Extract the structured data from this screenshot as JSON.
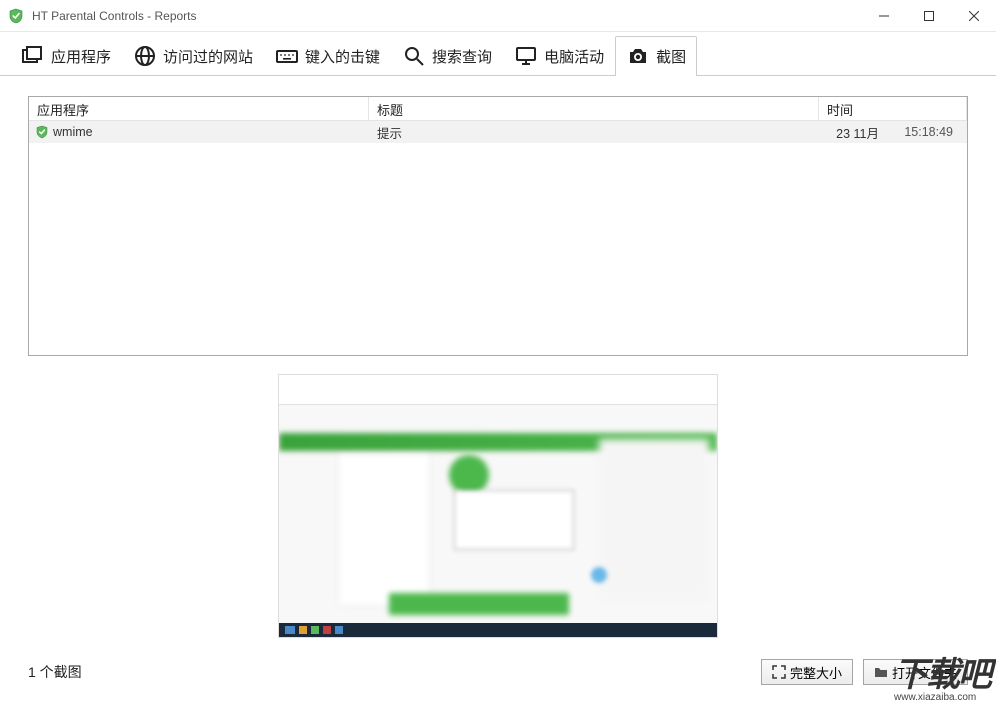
{
  "window": {
    "title": "HT Parental Controls - Reports"
  },
  "tabs": [
    {
      "id": "apps",
      "label": "应用程序"
    },
    {
      "id": "websites",
      "label": "访问过的网站"
    },
    {
      "id": "keystrokes",
      "label": "键入的击键"
    },
    {
      "id": "search",
      "label": "搜索查询"
    },
    {
      "id": "activity",
      "label": "电脑活动"
    },
    {
      "id": "screenshots",
      "label": "截图"
    }
  ],
  "active_tab": "screenshots",
  "table": {
    "headers": {
      "app": "应用程序",
      "title": "标题",
      "time": "时间"
    },
    "rows": [
      {
        "app": "wmime",
        "title": "提示",
        "date": "23 11月",
        "time": "15:18:49"
      }
    ]
  },
  "footer": {
    "count_label": "1 个截图",
    "fullsize_btn": "完整大小",
    "openfolder_btn": "打开文件夹"
  },
  "watermark": {
    "main": "下载吧",
    "sub": "www.xiazaiba.com"
  }
}
